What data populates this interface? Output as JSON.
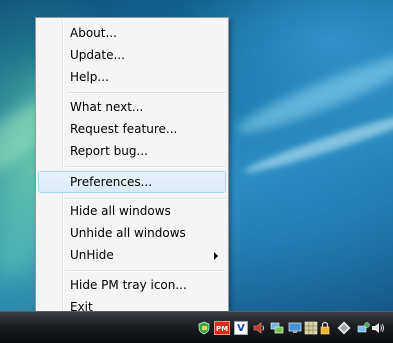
{
  "menu": {
    "items": [
      {
        "label": "About..."
      },
      {
        "label": "Update..."
      },
      {
        "label": "Help..."
      },
      {
        "label": "What next..."
      },
      {
        "label": "Request feature..."
      },
      {
        "label": "Report bug..."
      },
      {
        "label": "Preferences...",
        "highlighted": true
      },
      {
        "label": "Hide all windows"
      },
      {
        "label": "Unhide all windows"
      },
      {
        "label": "UnHide",
        "submenu": true
      },
      {
        "label": "Hide PM tray icon..."
      },
      {
        "label": "Exit"
      }
    ]
  },
  "tray": {
    "pm_icon_text": "PM",
    "v_icon_text": "V",
    "icons": [
      "shield-icon",
      "pm-app-icon",
      "v-app-icon",
      "speaker-icon",
      "network-icon",
      "monitor-icon",
      "grid-icon",
      "lock-icon",
      "diamond-icon",
      "safely-remove-icon",
      "volume-icon"
    ]
  },
  "colors": {
    "menu_bg": "#f5f5f5",
    "highlight_border": "#a8d8f0",
    "pm_icon_red": "#d92b1d",
    "taskbar": "#1c1e22"
  }
}
